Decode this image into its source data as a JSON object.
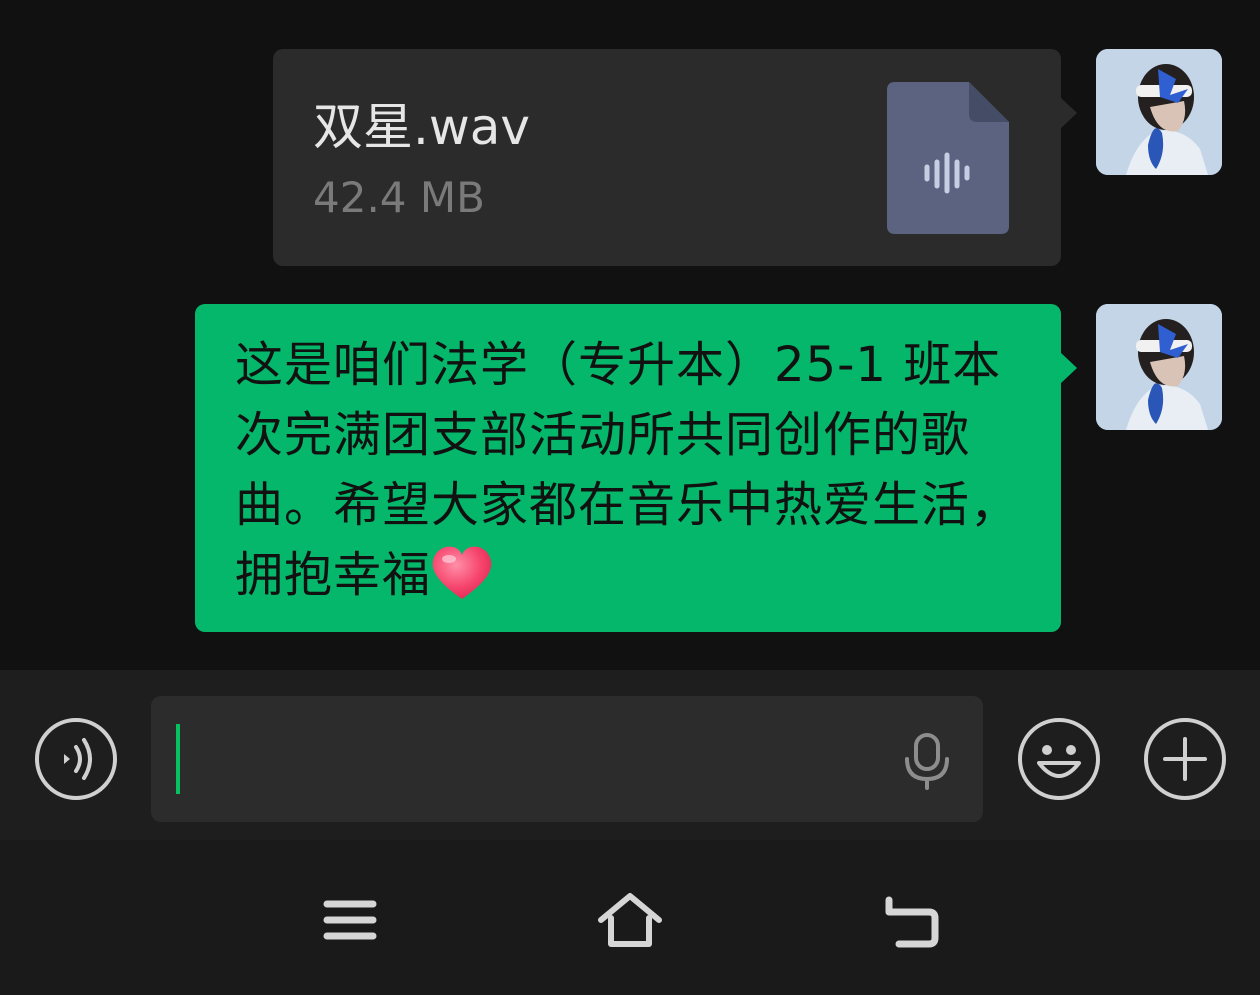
{
  "messages": [
    {
      "type": "file",
      "file_name": "双星.wav",
      "file_size": "42.4 MB",
      "icon": "audio-file-icon"
    },
    {
      "type": "text",
      "text": "这是咱们法学（专升本）25-1 班本次完满团支部活动所共同创作的歌曲。希望大家都在音乐中热爱生活，拥抱幸福",
      "emoji": "heart-emoji"
    }
  ],
  "input": {
    "value": "",
    "placeholder": ""
  },
  "icons": {
    "voice_toggle": "voice-mode-icon",
    "mic": "microphone-icon",
    "emoji": "emoji-icon",
    "more": "plus-icon",
    "nav_menu": "menu-icon",
    "nav_home": "home-icon",
    "nav_back": "back-icon"
  },
  "colors": {
    "background": "#111111",
    "own_bubble": "#05b76a",
    "file_bubble": "#2b2b2b",
    "input_caret": "#07c160"
  }
}
